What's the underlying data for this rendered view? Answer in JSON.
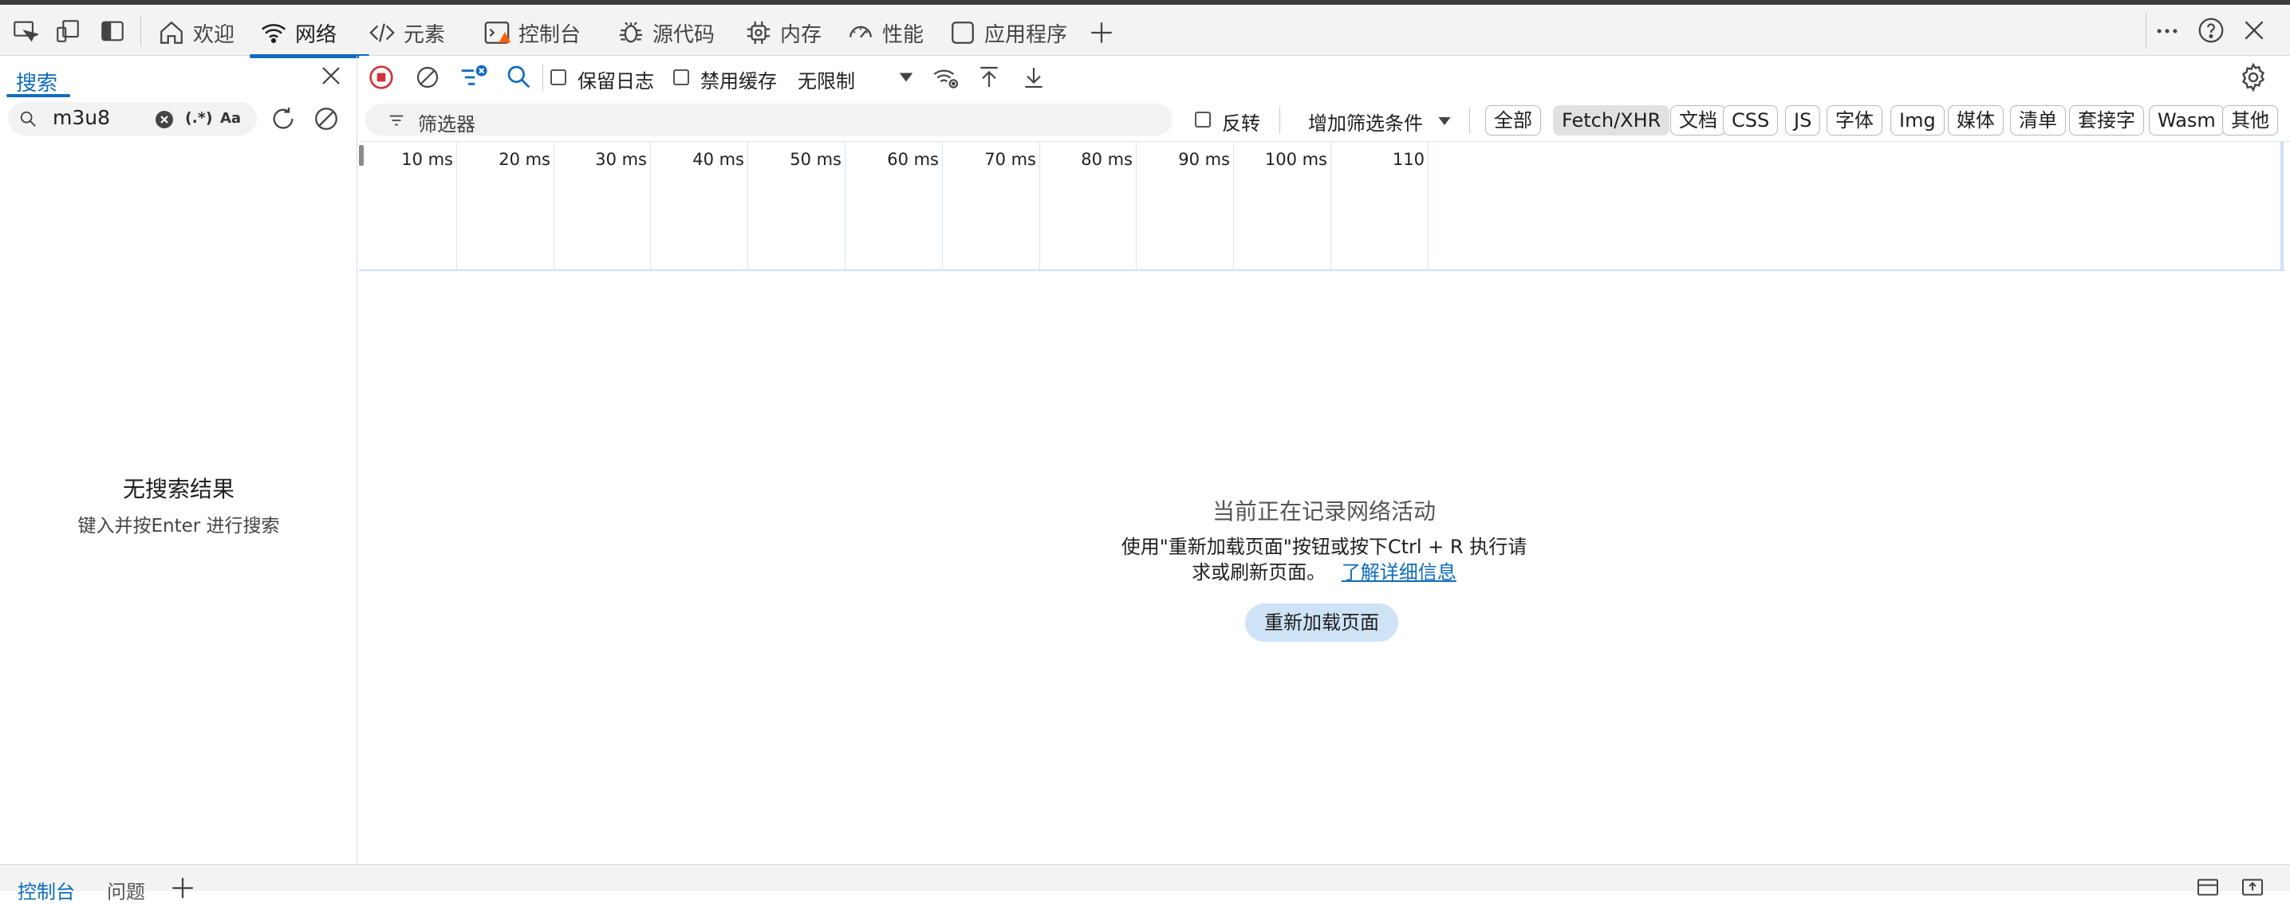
{
  "tabs": [
    {
      "label": "欢迎",
      "icon": "home-icon"
    },
    {
      "label": "网络",
      "icon": "wifi-icon"
    },
    {
      "label": "元素",
      "icon": "code-icon"
    },
    {
      "label": "控制台",
      "icon": "console-icon"
    },
    {
      "label": "源代码",
      "icon": "bug-icon"
    },
    {
      "label": "内存",
      "icon": "chip-icon"
    },
    {
      "label": "性能",
      "icon": "gauge-icon"
    },
    {
      "label": "应用程序",
      "icon": "window-icon"
    }
  ],
  "toolbar": {
    "preserve_log": "保留日志",
    "disable_cache": "禁用缓存",
    "throttling": "无限制"
  },
  "search": {
    "tab_label": "搜索",
    "query": "m3u8",
    "regex_label": "(.*)",
    "case_label": "Aa",
    "no_results_title": "无搜索结果",
    "no_results_hint": "键入并按Enter 进行搜索"
  },
  "filter": {
    "placeholder": "筛选器",
    "invert": "反转",
    "more_filters": "增加筛选条件",
    "chips": [
      "全部",
      "Fetch/XHR",
      "文档",
      "CSS",
      "JS",
      "字体",
      "Img",
      "媒体",
      "清单",
      "套接字",
      "Wasm",
      "其他"
    ],
    "selected": "Fetch/XHR"
  },
  "timeline": {
    "ticks": [
      "10 ms",
      "20 ms",
      "30 ms",
      "40 ms",
      "50 ms",
      "60 ms",
      "70 ms",
      "80 ms",
      "90 ms",
      "100 ms",
      "110"
    ]
  },
  "empty_state": {
    "title": "当前正在记录网络活动",
    "line1": "使用\"重新加载页面\"按钮或按下Ctrl + R 执行请",
    "line2": "求或刷新页面。",
    "link": "了解详细信息",
    "button": "重新加载页面"
  },
  "drawer": {
    "tab1": "控制台",
    "tab2": "问题"
  },
  "colors": {
    "accent": "#0f6cbd",
    "record_red": "#d13438",
    "warning_orange": "#f7630c"
  }
}
